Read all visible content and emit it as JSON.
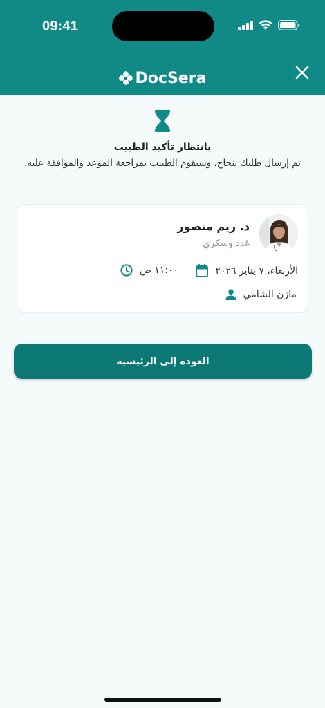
{
  "status_bar": {
    "time": "09:41",
    "icons": [
      "cellular-signal-icon",
      "wifi-icon",
      "battery-icon"
    ]
  },
  "header": {
    "logo_text": "DocSera",
    "logo_icon": "plus-clover-icon",
    "close_icon": "close-icon"
  },
  "pending": {
    "icon": "hourglass-icon",
    "title": "بانتظار تأكيد الطبيب",
    "description": "تم إرسال طلبك بنجاح، وسيقوم الطبيب بمراجعة الموعد والموافقة عليه."
  },
  "appointment": {
    "doctor_name": "د. ريم منصور",
    "specialty": "غدد وسكري",
    "date": "الأربعاء، ٧ يناير ٢٠٢٦",
    "time": "١١:٠٠ ص",
    "patient": "مازن الشامي"
  },
  "actions": {
    "home_button": "العودة إلى الرئيسية"
  },
  "colors": {
    "brand": "#0f8a87",
    "button": "#0c7876",
    "background": "#f4fbfa"
  }
}
